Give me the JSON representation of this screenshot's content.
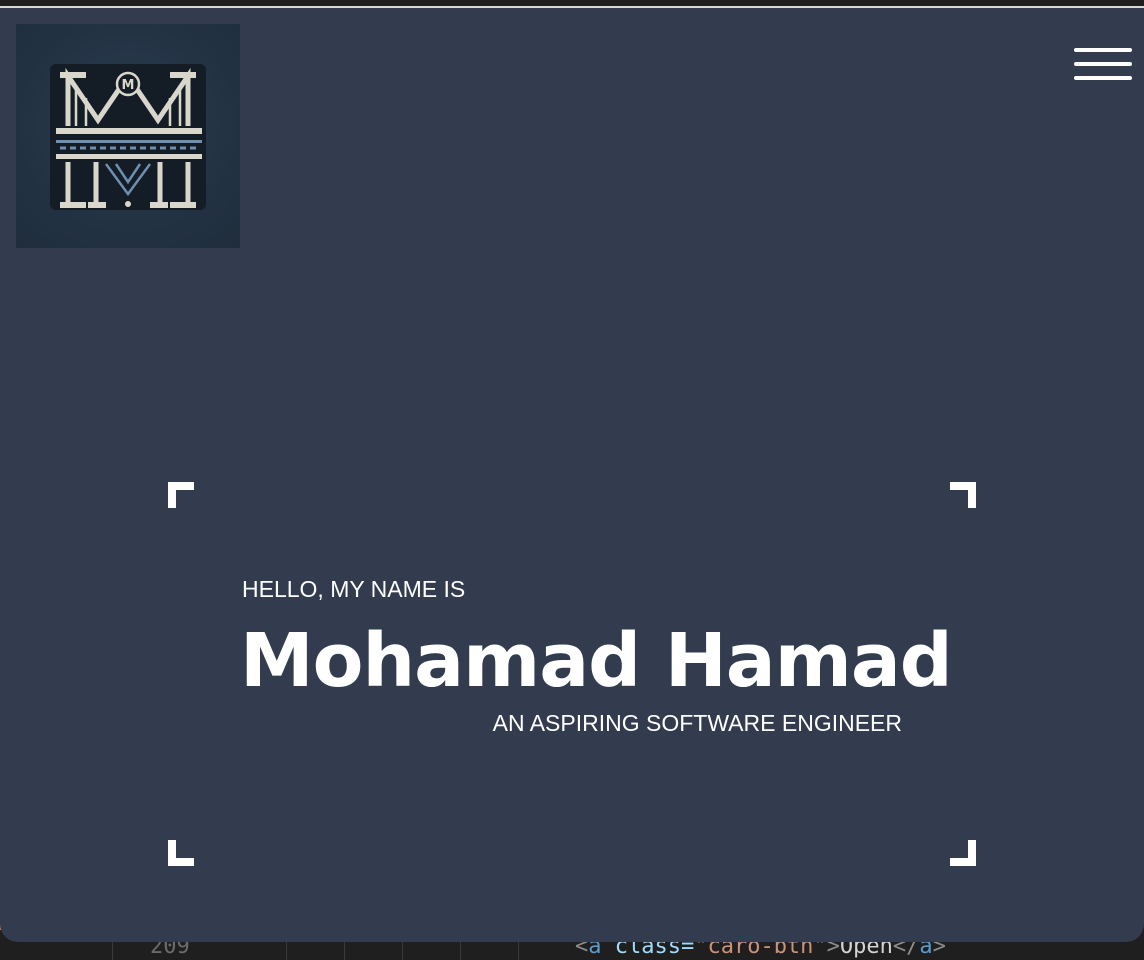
{
  "header": {
    "logo_icon": "monogram-m-logo-icon",
    "logo_letters": "MM",
    "menu_icon": "hamburger-menu-icon"
  },
  "hero": {
    "greeting": "HELLO, MY NAME IS",
    "name": "Mohamad Hamad",
    "tagline": "AN ASPIRING SOFTWARE ENGINEER"
  },
  "editor_peek": {
    "line_number": "209",
    "code_open": "<",
    "code_tag": "a",
    "code_attr": " class=",
    "code_value": "\"caro-btn\"",
    "code_close": ">",
    "code_text": "Open",
    "code_end_open": "</",
    "code_end_tag": "a",
    "code_end_close": ">"
  },
  "colors": {
    "background": "#323c4e",
    "text": "#ffffff",
    "accent": "#e07a2e"
  }
}
